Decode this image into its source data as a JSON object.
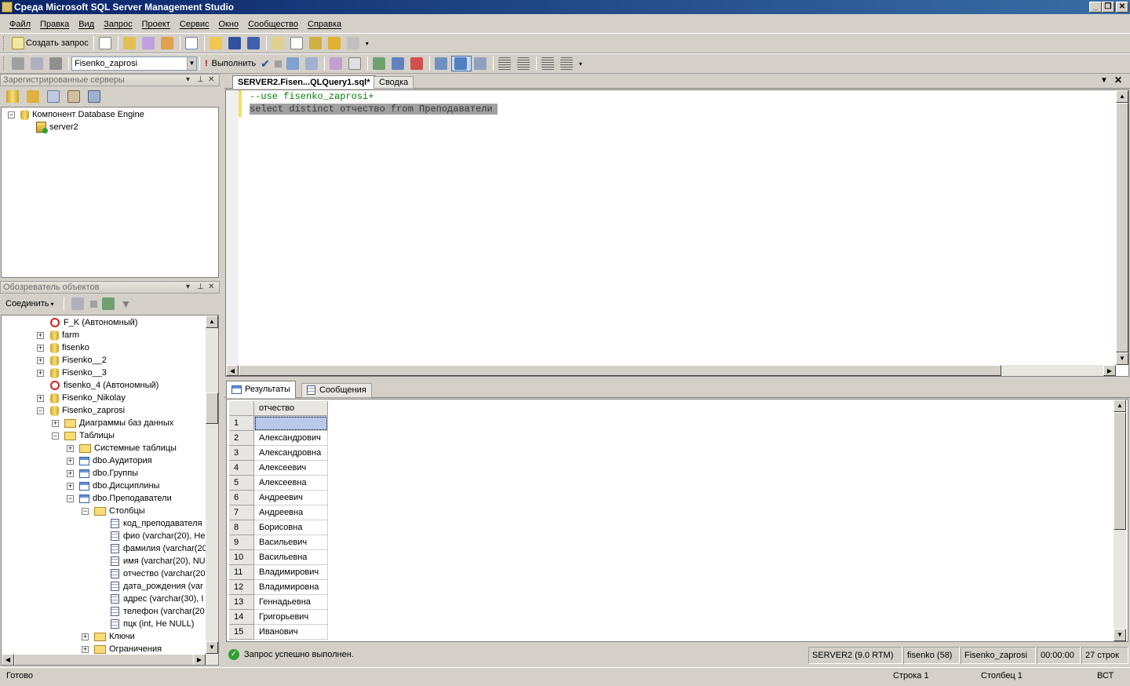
{
  "window": {
    "title": "Среда Microsoft SQL Server Management Studio"
  },
  "menu": [
    "Файл",
    "Правка",
    "Вид",
    "Запрос",
    "Проект",
    "Сервис",
    "Окно",
    "Сообщество",
    "Справка"
  ],
  "toolbar1": {
    "new_query": "Создать запрос"
  },
  "toolbar2": {
    "database": "Fisenko_zaprosi",
    "execute": "Выполнить"
  },
  "registered_servers": {
    "title": "Зарегистрированные серверы",
    "nodes": [
      "Компонент Database Engine",
      "server2"
    ]
  },
  "object_explorer": {
    "title": "Обозреватель объектов",
    "connect": "Соединить",
    "nodes": [
      "F_K (Автономный)",
      "farm",
      "fisenko",
      "Fisenko__2",
      "Fisenko__3",
      "fisenko_4 (Автономный)",
      "Fisenko_Nikolay",
      "Fisenko_zaprosi",
      "Диаграммы баз данных",
      "Таблицы",
      "Системные таблицы",
      "dbo.Аудитория",
      "dbo.Группы",
      "dbo.Дисциплины",
      "dbo.Преподаватели",
      "Столбцы",
      "код_преподавателя",
      "фио (varchar(20), Не",
      "фамилия (varchar(20",
      "имя (varchar(20), NU",
      "отчество (varchar(20",
      "дата_рождения (var",
      "адрес (varchar(30), I",
      "телефон (varchar(20",
      "пцк (int, Не NULL)",
      "Ключи",
      "Ограничения"
    ]
  },
  "editor": {
    "tabs": [
      "SERVER2.Fisen...QLQuery1.sql*",
      "Сводка"
    ],
    "lines": [
      "--use fisenko_zaprosi+",
      "select distinct отчество from Преподаватели"
    ]
  },
  "results": {
    "tabs": [
      "Результаты",
      "Сообщения"
    ],
    "column": "отчество",
    "rows": [
      [
        "1",
        ""
      ],
      [
        "2",
        "Александрович"
      ],
      [
        "3",
        "Александровна"
      ],
      [
        "4",
        "Алексеевич"
      ],
      [
        "5",
        "Алексеевна"
      ],
      [
        "6",
        "Андреевич"
      ],
      [
        "7",
        "Андреевна"
      ],
      [
        "8",
        "Борисовна"
      ],
      [
        "9",
        "Васильевич"
      ],
      [
        "10",
        "Васильевна"
      ],
      [
        "11",
        "Владимирович"
      ],
      [
        "12",
        "Владимировна"
      ],
      [
        "13",
        "Геннадьевна"
      ],
      [
        "14",
        "Григорьевич"
      ],
      [
        "15",
        "Иванович"
      ]
    ]
  },
  "query_status": {
    "message": "Запрос успешно выполнен.",
    "server": "SERVER2 (9.0 RTM)",
    "user": "fisenko (58)",
    "database": "Fisenko_zaprosi",
    "time": "00:00:00",
    "rows": "27 строк"
  },
  "statusbar": {
    "ready": "Готово",
    "line": "Строка 1",
    "col": "Столбец 1",
    "mode": "ВСТ"
  }
}
